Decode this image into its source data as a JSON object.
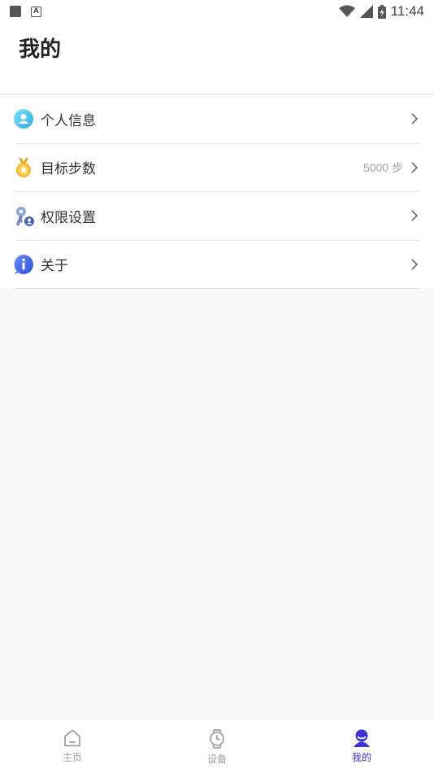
{
  "status_bar": {
    "time": "11:44"
  },
  "header": {
    "title": "我的"
  },
  "menu": {
    "items": [
      {
        "label": "个人信息",
        "icon": "user-icon"
      },
      {
        "label": "目标步数",
        "icon": "medal-icon",
        "value": "5000 步"
      },
      {
        "label": "权限设置",
        "icon": "key-icon"
      },
      {
        "label": "关于",
        "icon": "info-icon"
      }
    ]
  },
  "bottom_nav": {
    "items": [
      {
        "label": "主页",
        "icon": "home-icon",
        "active": false
      },
      {
        "label": "设备",
        "icon": "watch-icon",
        "active": false
      },
      {
        "label": "我的",
        "icon": "profile-icon",
        "active": true
      }
    ],
    "active_color": "#3a33d6",
    "inactive_color": "#a0a0aa"
  }
}
